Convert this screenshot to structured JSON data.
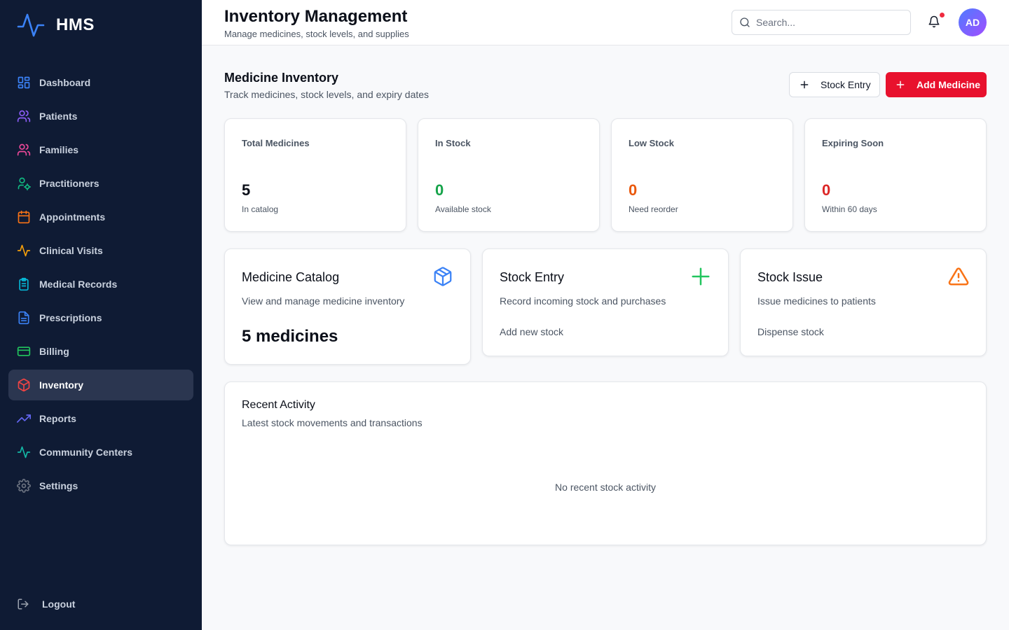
{
  "app": {
    "name": "HMS",
    "brand_color": "#3b82f6"
  },
  "sidebar": {
    "items": [
      {
        "label": "Dashboard",
        "icon": "dashboard-grid-icon",
        "color": "#3b82f6"
      },
      {
        "label": "Patients",
        "icon": "users-icon",
        "color": "#8b5cf6"
      },
      {
        "label": "Families",
        "icon": "users-icon",
        "color": "#ec4899"
      },
      {
        "label": "Practitioners",
        "icon": "user-cog-icon",
        "color": "#10b981"
      },
      {
        "label": "Appointments",
        "icon": "calendar-icon",
        "color": "#f97316"
      },
      {
        "label": "Clinical Visits",
        "icon": "activity-icon",
        "color": "#f59e0b"
      },
      {
        "label": "Medical Records",
        "icon": "clipboard-icon",
        "color": "#06b6d4"
      },
      {
        "label": "Prescriptions",
        "icon": "file-text-icon",
        "color": "#3b82f6"
      },
      {
        "label": "Billing",
        "icon": "credit-card-icon",
        "color": "#22c55e"
      },
      {
        "label": "Inventory",
        "icon": "package-icon",
        "color": "#ef4444",
        "active": true
      },
      {
        "label": "Reports",
        "icon": "trending-up-icon",
        "color": "#6366f1"
      },
      {
        "label": "Community Centers",
        "icon": "activity-icon",
        "color": "#14b8a6"
      },
      {
        "label": "Settings",
        "icon": "gear-icon",
        "color": "#6b7280"
      }
    ],
    "logout_label": "Logout"
  },
  "header": {
    "title": "Inventory Management",
    "subtitle": "Manage medicines, stock levels, and supplies",
    "search_placeholder": "Search...",
    "avatar_initials": "AD",
    "notification_dot_color": "#ef2a3f"
  },
  "main": {
    "section_title": "Medicine Inventory",
    "section_subtitle": "Track medicines, stock levels, and expiry dates",
    "stock_entry_button": "Stock Entry",
    "add_medicine_button": "Add Medicine",
    "primary_color": "#e8112d",
    "stats": [
      {
        "label": "Total Medicines",
        "value": "5",
        "note": "In catalog",
        "color": "#0b0f19"
      },
      {
        "label": "In Stock",
        "value": "0",
        "note": "Available stock",
        "color": "#16a34a"
      },
      {
        "label": "Low Stock",
        "value": "0",
        "note": "Need reorder",
        "color": "#ea580c"
      },
      {
        "label": "Expiring Soon",
        "value": "0",
        "note": "Within 60 days",
        "color": "#dc2626"
      }
    ],
    "features": [
      {
        "title": "Medicine Catalog",
        "description": "View and manage medicine inventory",
        "highlight": "5 medicines",
        "icon": "package-icon",
        "icon_color": "#3b82f6"
      },
      {
        "title": "Stock Entry",
        "description": "Record incoming stock and purchases",
        "link": "Add new stock",
        "icon": "plus-icon",
        "icon_color": "#22c55e"
      },
      {
        "title": "Stock Issue",
        "description": "Issue medicines to patients",
        "link": "Dispense stock",
        "icon": "alert-triangle-icon",
        "icon_color": "#f97316"
      }
    ],
    "activity": {
      "title": "Recent Activity",
      "subtitle": "Latest stock movements and transactions",
      "empty_text": "No recent stock activity"
    }
  }
}
